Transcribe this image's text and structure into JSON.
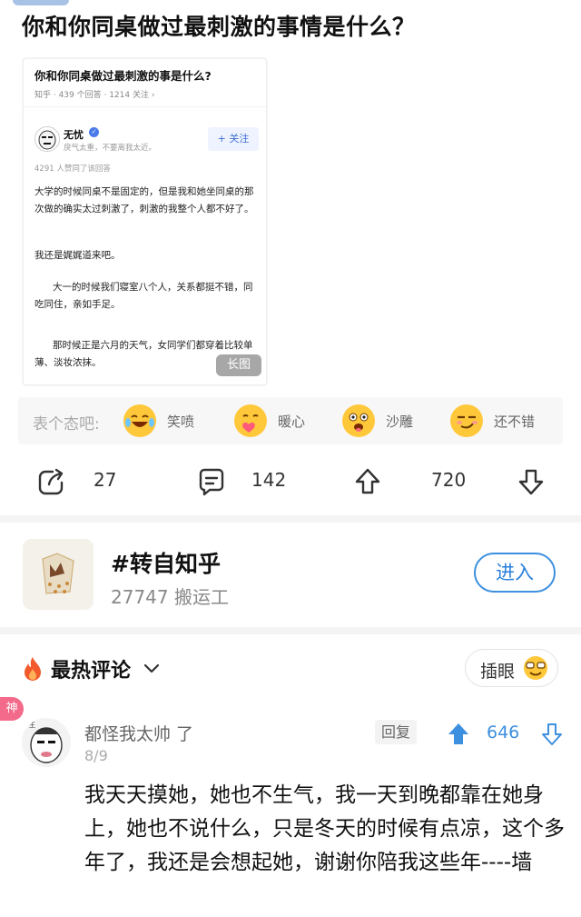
{
  "post": {
    "title": "你和你同桌做过最刺激的事情是什么？"
  },
  "card": {
    "title": "你和你同桌做过最刺激的事是什么?",
    "meta": "知乎 · 439 个回答 · 1214 关注 ›",
    "author": "无忧",
    "bio": "戾气太重，不要离我太近。",
    "follow_label": "+ 关注",
    "likes": "4291 人赞同了该回答",
    "paragraphs": [
      "大学的时候同桌不是固定的，但是我和她坐同桌的那次做的确实太过刺激了，刺激的我整个人都不好了。",
      "我还是娓娓道来吧。",
      "大一的时候我们寝室八个人，关系都挺不错，同吃同住，亲如手足。",
      "那时候正是六月的天气，女同学们都穿着比较单薄、淡妆浓抹。"
    ],
    "long_image_label": "长图"
  },
  "reactions": {
    "prompt": "表个态吧:",
    "items": [
      {
        "label": "笑喷",
        "icon": "laugh-tears-emoji"
      },
      {
        "label": "暖心",
        "icon": "heart-hug-emoji"
      },
      {
        "label": "沙雕",
        "icon": "silly-face-emoji"
      },
      {
        "label": "还不错",
        "icon": "smirk-emoji"
      }
    ]
  },
  "actions": {
    "share_count": "27",
    "comment_count": "142",
    "upvote_count": "720"
  },
  "group": {
    "name": "#转自知乎",
    "count": "27747 搬运工",
    "enter_label": "进入"
  },
  "hot_comments": {
    "title": "最热评论",
    "insert_label": "插眼",
    "comment": {
      "badge": "神",
      "user": "都怪我太帅 了",
      "date": "8/9",
      "reply_label": "回复",
      "upvotes": "646",
      "text": "我天天摸她，她也不生气，我一天到晚都靠在她身上，她也不说什么，只是冬天的时候有点凉，这个多年了，我还是会想起她，谢谢你陪我这些年----墙"
    }
  },
  "colors": {
    "accent_blue": "#3d8fe0",
    "fire_orange": "#f25a2c",
    "emoji_yellow": "#ffc83a",
    "shen_pink": "#f36a8a"
  }
}
